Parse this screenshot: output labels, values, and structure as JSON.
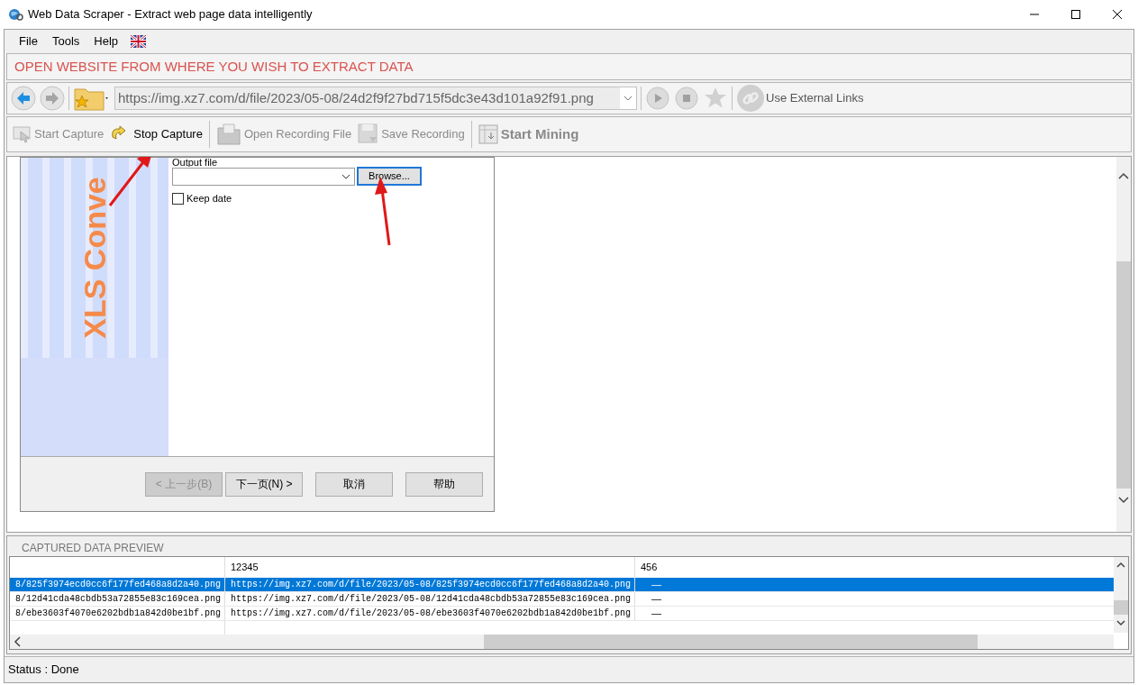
{
  "window": {
    "title": "Web Data Scraper -  Extract web page data intelligently"
  },
  "menu": [
    "File",
    "Tools",
    "Help"
  ],
  "header": "OPEN WEBSITE FROM WHERE YOU WISH TO EXTRACT DATA",
  "address": {
    "value": "https://img.xz7.com/d/file/2023/05-08/24d2f9f27bd715f5dc3e43d101a92f91.png"
  },
  "external_links": "Use External Links",
  "toolbar": [
    {
      "label": "Start Capture",
      "disabled": true,
      "bold": false
    },
    {
      "label": "Stop Capture",
      "disabled": false,
      "bold": false
    },
    {
      "label": "Open Recording File",
      "disabled": true,
      "bold": false
    },
    {
      "label": "Save Recording",
      "disabled": true,
      "bold": false
    },
    {
      "label": "Start Mining",
      "disabled": true,
      "bold": true
    }
  ],
  "dialog": {
    "banner_text": "XLS Conve",
    "output_label": "Output file",
    "browse": "Browse...",
    "keep_date": {
      "label": "Keep date",
      "checked": false
    },
    "buttons": [
      {
        "label": "< 上一步(B)",
        "disabled": true
      },
      {
        "label": "下一页(N) >",
        "disabled": false
      },
      {
        "label": "取消",
        "disabled": false
      },
      {
        "label": "帮助",
        "disabled": false
      }
    ]
  },
  "preview": {
    "title": "CAPTURED DATA PREVIEW",
    "columns": [
      {},
      {
        "label": "12345"
      },
      {
        "label": "456"
      }
    ],
    "rows": [
      {
        "selected": true,
        "cells": [
          "8/825f3974ecd0cc6f177fed468a8d2a40.png",
          "https://img.xz7.com/d/file/2023/05-08/825f3974ecd0cc6f177fed468a8d2a40.png",
          "—"
        ]
      },
      {
        "selected": false,
        "cells": [
          "8/12d41cda48cbdb53a72855e83c169cea.png",
          "https://img.xz7.com/d/file/2023/05-08/12d41cda48cbdb53a72855e83c169cea.png",
          "—"
        ]
      },
      {
        "selected": false,
        "cells": [
          "8/ebe3603f4070e6202bdb1a842d0be1bf.png",
          "https://img.xz7.com/d/file/2023/05-08/ebe3603f4070e6202bdb1a842d0be1bf.png",
          "—"
        ]
      }
    ]
  },
  "status_bar": "Status :  Done"
}
